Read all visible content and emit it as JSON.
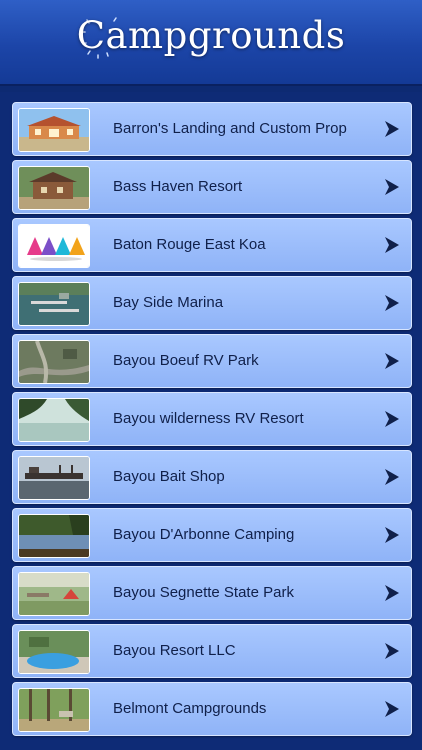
{
  "header": {
    "title": "Campgrounds",
    "background": "#1c45a8"
  },
  "list": {
    "items": [
      {
        "label": "Barron's Landing and Custom Prop",
        "thumb": "lodge-photo"
      },
      {
        "label": "Bass Haven Resort",
        "thumb": "cabin-photo"
      },
      {
        "label": "Baton Rouge East Koa",
        "thumb": "koa-logo"
      },
      {
        "label": "Bay Side Marina",
        "thumb": "marina-aerial-photo"
      },
      {
        "label": "Bayou Boeuf RV Park",
        "thumb": "aerial-map-photo"
      },
      {
        "label": "Bayou wilderness RV Resort",
        "thumb": "lake-trees-photo"
      },
      {
        "label": "Bayou Bait Shop",
        "thumb": "dock-photo"
      },
      {
        "label": "Bayou D'Arbonne Camping",
        "thumb": "lake-forest-photo"
      },
      {
        "label": "Bayou Segnette State Park",
        "thumb": "campsite-tent-photo"
      },
      {
        "label": "Bayou Resort LLC",
        "thumb": "pool-photo"
      },
      {
        "label": "Belmont Campgrounds",
        "thumb": "forest-photo"
      }
    ],
    "row_color": "#9dbdfb",
    "text_color": "#10204a",
    "arrow_icon": "chevron-right-icon"
  }
}
